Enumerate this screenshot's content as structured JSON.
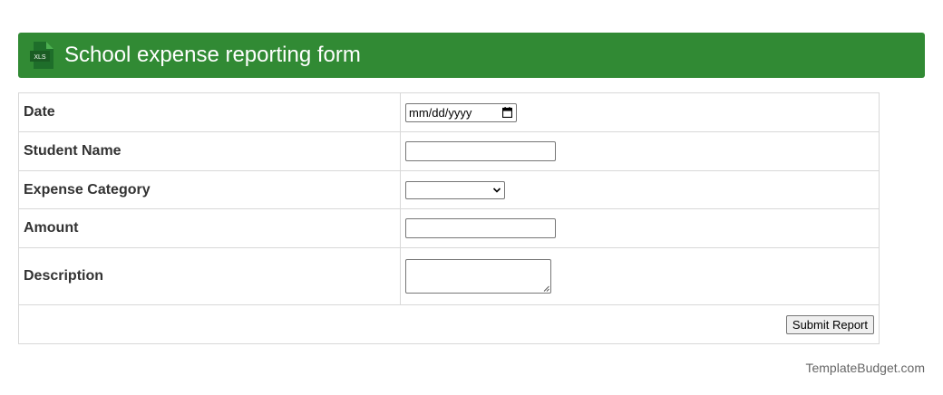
{
  "header": {
    "icon": "xls-file-icon",
    "icon_text": "XLS",
    "title": "School expense reporting form",
    "background_color": "#318a34"
  },
  "form": {
    "fields": [
      {
        "label": "Date",
        "type": "date",
        "placeholder": "mm/dd/yyyy"
      },
      {
        "label": "Student Name",
        "type": "text",
        "value": ""
      },
      {
        "label": "Expense Category",
        "type": "select",
        "selected": ""
      },
      {
        "label": "Amount",
        "type": "text",
        "value": ""
      },
      {
        "label": "Description",
        "type": "textarea",
        "value": ""
      }
    ],
    "submit_label": "Submit Report"
  },
  "footer": {
    "brand": "TemplateBudget.com"
  }
}
